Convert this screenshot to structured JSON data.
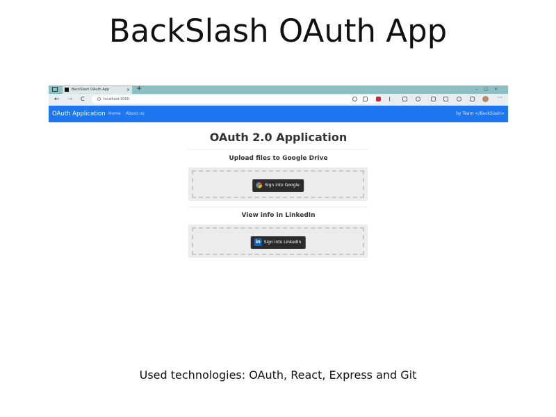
{
  "slide": {
    "title": "BackSlash OAuth App",
    "caption": "Used technologies: OAuth, React, Express and Git"
  },
  "browser": {
    "tab_title": "BackSlash OAuth App",
    "tab_close": "×",
    "new_tab": "+",
    "window_controls": "–□×",
    "back": "←",
    "forward": "→",
    "reload": "C",
    "url": "localhost:3000",
    "more": "···"
  },
  "navbar": {
    "brand": "OAuth Application",
    "links": [
      "Home",
      "About us"
    ],
    "right_text": "by Team </BackSlash>"
  },
  "main": {
    "title": "OAuth 2.0 Application",
    "google_section_title": "Upload files to Google Drive",
    "google_button": "Sign into Google",
    "linkedin_section_title": "View info in LinkedIn",
    "linkedin_icon_text": "in",
    "linkedin_button": "Sign into LinkedIn"
  },
  "colors": {
    "navbar": "#1e76f0",
    "tabbar": "#8bbfc4",
    "button": "#2b2b2b",
    "linkedin": "#0a66c2"
  }
}
